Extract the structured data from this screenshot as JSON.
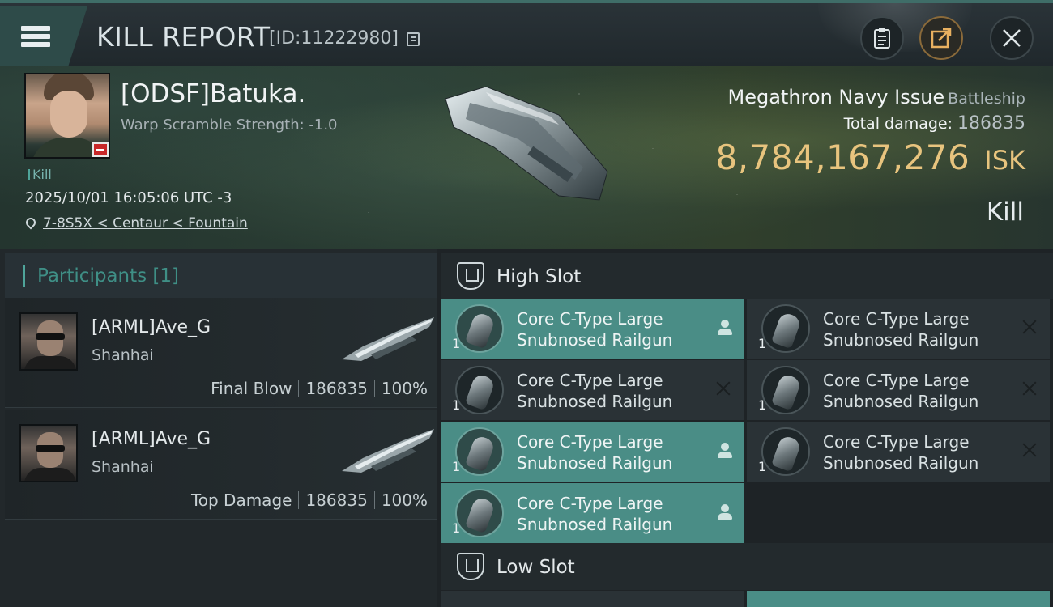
{
  "header": {
    "title": "KILL REPORT",
    "id_text": "[ID:11222980]"
  },
  "victim": {
    "name": "[ODSF]Batuka.",
    "warp_scramble": "Warp Scramble Strength: -1.0",
    "tag": "Kill",
    "timestamp": "2025/10/01 16:05:06 UTC -3",
    "location": "7-8S5X < Centaur < Fountain",
    "ship_type": "Megathron Navy Issue",
    "ship_class": "Battleship",
    "total_damage_label": "Total damage:",
    "total_damage_value": "186835",
    "isk_value": "8,784,167,276",
    "isk_unit": "ISK",
    "result": "Kill"
  },
  "participants": {
    "title": "Participants [1]",
    "items": [
      {
        "name": "[ARML]Ave_G",
        "corp": "Shanhai",
        "label": "Final Blow",
        "damage": "186835",
        "percent": "100%"
      },
      {
        "name": "[ARML]Ave_G",
        "corp": "Shanhai",
        "label": "Top Damage",
        "damage": "186835",
        "percent": "100%"
      }
    ]
  },
  "fitting": {
    "high_slot_title": "High Slot",
    "low_slot_title": "Low Slot",
    "high_modules": [
      {
        "line1": "Core C-Type Large",
        "line2": "Snubnosed Railgun",
        "qty": "1",
        "status": "fitted"
      },
      {
        "line1": "Core C-Type Large",
        "line2": "Snubnosed Railgun",
        "qty": "1",
        "status": "destroyed"
      },
      {
        "line1": "Core C-Type Large",
        "line2": "Snubnosed Railgun",
        "qty": "1",
        "status": "destroyed"
      },
      {
        "line1": "Core C-Type Large",
        "line2": "Snubnosed Railgun",
        "qty": "1",
        "status": "destroyed"
      },
      {
        "line1": "Core C-Type Large",
        "line2": "Snubnosed Railgun",
        "qty": "1",
        "status": "fitted"
      },
      {
        "line1": "Core C-Type Large",
        "line2": "Snubnosed Railgun",
        "qty": "1",
        "status": "destroyed"
      },
      {
        "line1": "Core C-Type Large",
        "line2": "Snubnosed Railgun",
        "qty": "1",
        "status": "fitted"
      }
    ]
  },
  "colors": {
    "accent_teal": "#4a8d86",
    "isk_gold": "#e8c47e",
    "badge_red": "#c8282a"
  },
  "icons": [
    "menu-icon",
    "copy-icon",
    "clipboard-icon",
    "share-icon",
    "close-icon",
    "pin-icon",
    "slot-icon",
    "pilot-icon",
    "destroyed-x-icon"
  ]
}
